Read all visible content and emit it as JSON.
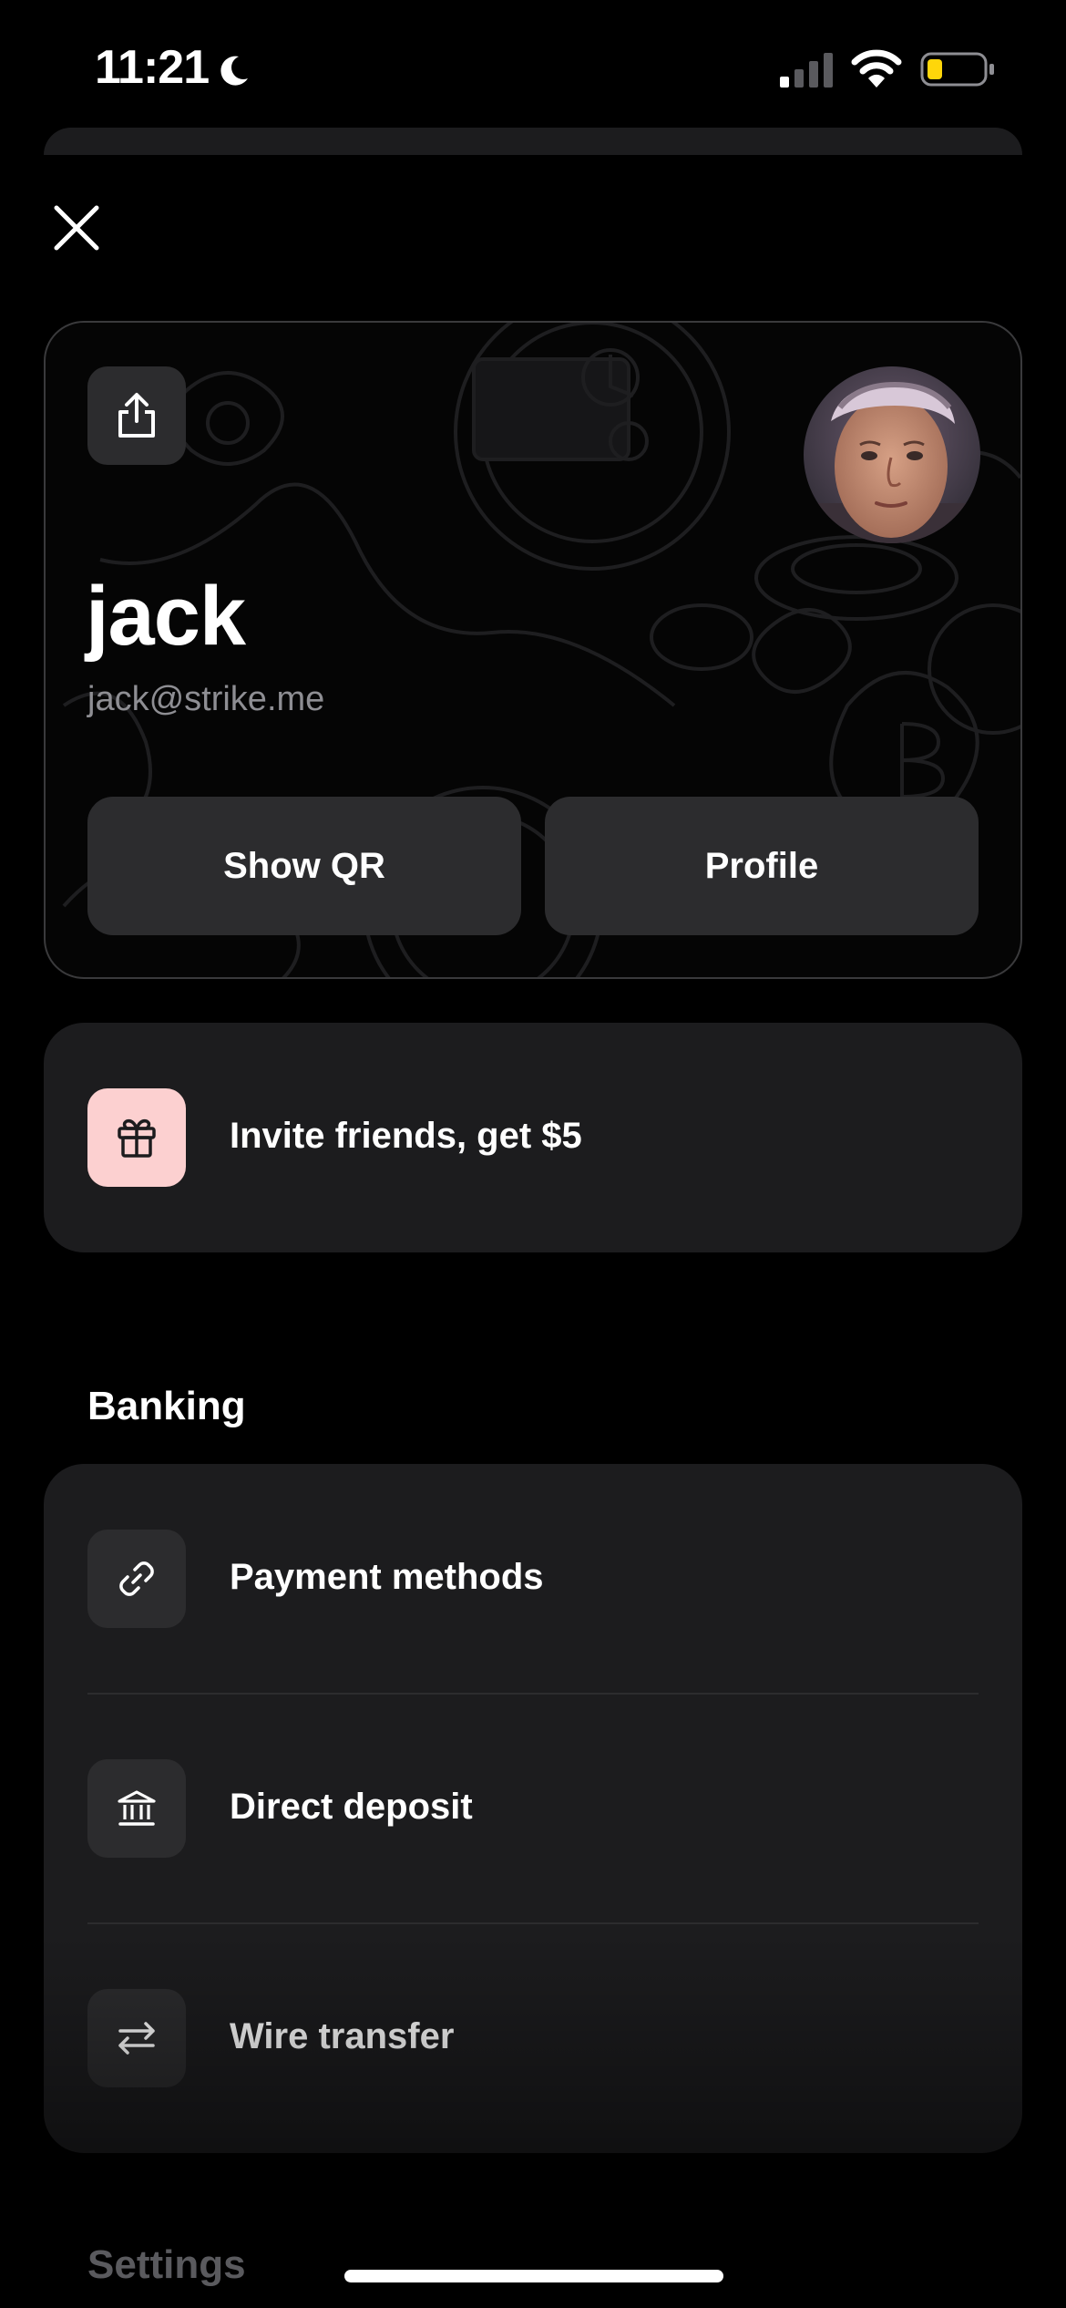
{
  "status_bar": {
    "time": "11:21",
    "icons": [
      "moon-icon",
      "cellular-signal-icon",
      "wifi-icon",
      "battery-icon"
    ],
    "battery_color": "#ffd60a"
  },
  "profile_card": {
    "name": "jack",
    "email": "jack@strike.me",
    "show_qr_label": "Show QR",
    "profile_label": "Profile",
    "share_icon": "share-icon"
  },
  "invite": {
    "label": "Invite friends, get $5",
    "icon": "gift-icon",
    "icon_bg": "#fcd0d0"
  },
  "banking": {
    "title": "Banking",
    "items": [
      {
        "label": "Payment methods",
        "icon": "link-icon"
      },
      {
        "label": "Direct deposit",
        "icon": "bank-icon"
      },
      {
        "label": "Wire transfer",
        "icon": "transfer-arrows-icon"
      }
    ]
  },
  "settings": {
    "title": "Settings"
  },
  "colors": {
    "background": "#000000",
    "card": "#1c1c1e",
    "button": "#2c2c2e",
    "secondary_text": "#8e8e93"
  }
}
